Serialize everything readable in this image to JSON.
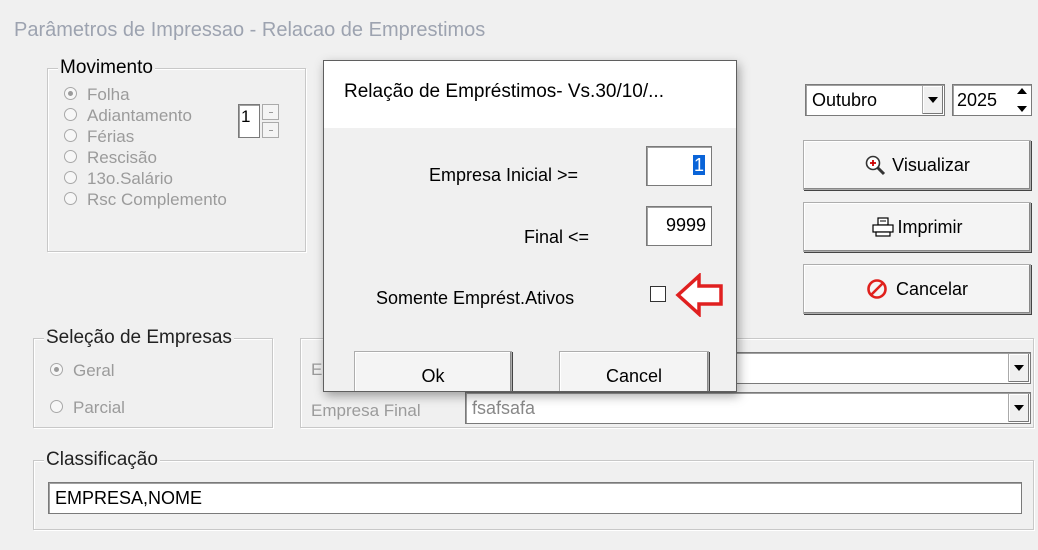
{
  "window": {
    "title": "Parâmetros de Impressao - Relacao de Emprestimos"
  },
  "movimento": {
    "legend": "Movimento",
    "options": [
      {
        "label": "Folha",
        "selected": true
      },
      {
        "label": "Adiantamento",
        "selected": false
      },
      {
        "label": "Férias",
        "selected": false
      },
      {
        "label": "Rescisão",
        "selected": false
      },
      {
        "label": "13o.Salário",
        "selected": false
      },
      {
        "label": "Rsc Complemento",
        "selected": false
      }
    ],
    "adiantamento_spin_value": "1"
  },
  "period": {
    "month": "Outubro",
    "year": "2025"
  },
  "buttons": {
    "visualizar": "Visualizar",
    "imprimir": "Imprimir",
    "cancelar": "Cancelar"
  },
  "selecao": {
    "legend": "Seleção de Empresas",
    "options": [
      {
        "label": "Geral",
        "selected": true
      },
      {
        "label": "Parcial",
        "selected": false
      }
    ],
    "empresa_inicial_label_partial": "E",
    "empresa_final_label": "Empresa Final",
    "empresa_final_value": "fsafsafa",
    "empresa_inicial_value": ""
  },
  "classificacao": {
    "legend": "Classificação",
    "value": "EMPRESA,NOME"
  },
  "dialog": {
    "title": "Relação de Empréstimos- Vs.30/10/...",
    "empresa_inicial_label": "Empresa  Inicial >=",
    "empresa_inicial_value": "1",
    "final_label": "Final <=",
    "final_value": "9999",
    "somente_label": "Somente Emprést.Ativos",
    "somente_checked": false,
    "ok_label": "Ok",
    "cancel_label": "Cancel"
  },
  "colors": {
    "annotation_arrow": "#e02020",
    "disabled_text": "#9b9b9b"
  },
  "icons": [
    "zoom-in-icon",
    "printer-icon",
    "cancel-circle-icon",
    "arrow-left-icon"
  ]
}
